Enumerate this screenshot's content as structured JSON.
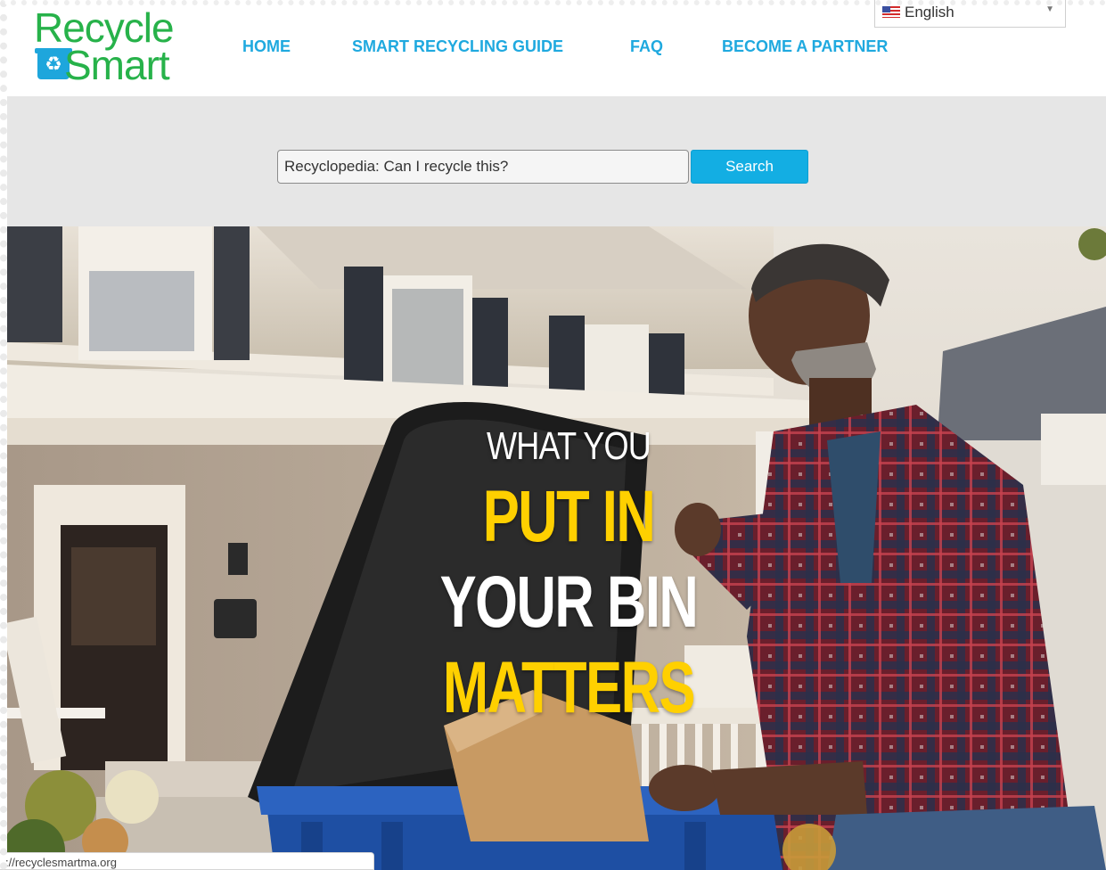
{
  "brand": {
    "logo_word1": "Recycle",
    "logo_word2": "Smart",
    "logo_icon": "recycle-bin-icon",
    "primary_green": "#27b24a",
    "accent_blue": "#1fa9df"
  },
  "nav": {
    "items": [
      {
        "label": "HOME"
      },
      {
        "label": "SMART RECYCLING GUIDE"
      },
      {
        "label": "FAQ"
      },
      {
        "label": "BECOME A PARTNER"
      }
    ]
  },
  "language": {
    "selected": "English",
    "flag_icon": "us-flag-icon"
  },
  "search": {
    "placeholder": "Recyclopedia: Can I recycle this?",
    "button_label": "Search"
  },
  "hero": {
    "line1": "WHAT YOU",
    "line2": "PUT IN",
    "line3": "YOUR BIN",
    "line4": "MATTERS",
    "highlight_color": "#ffd000"
  },
  "status_bar": {
    "url": "://recyclesmartma.org"
  }
}
